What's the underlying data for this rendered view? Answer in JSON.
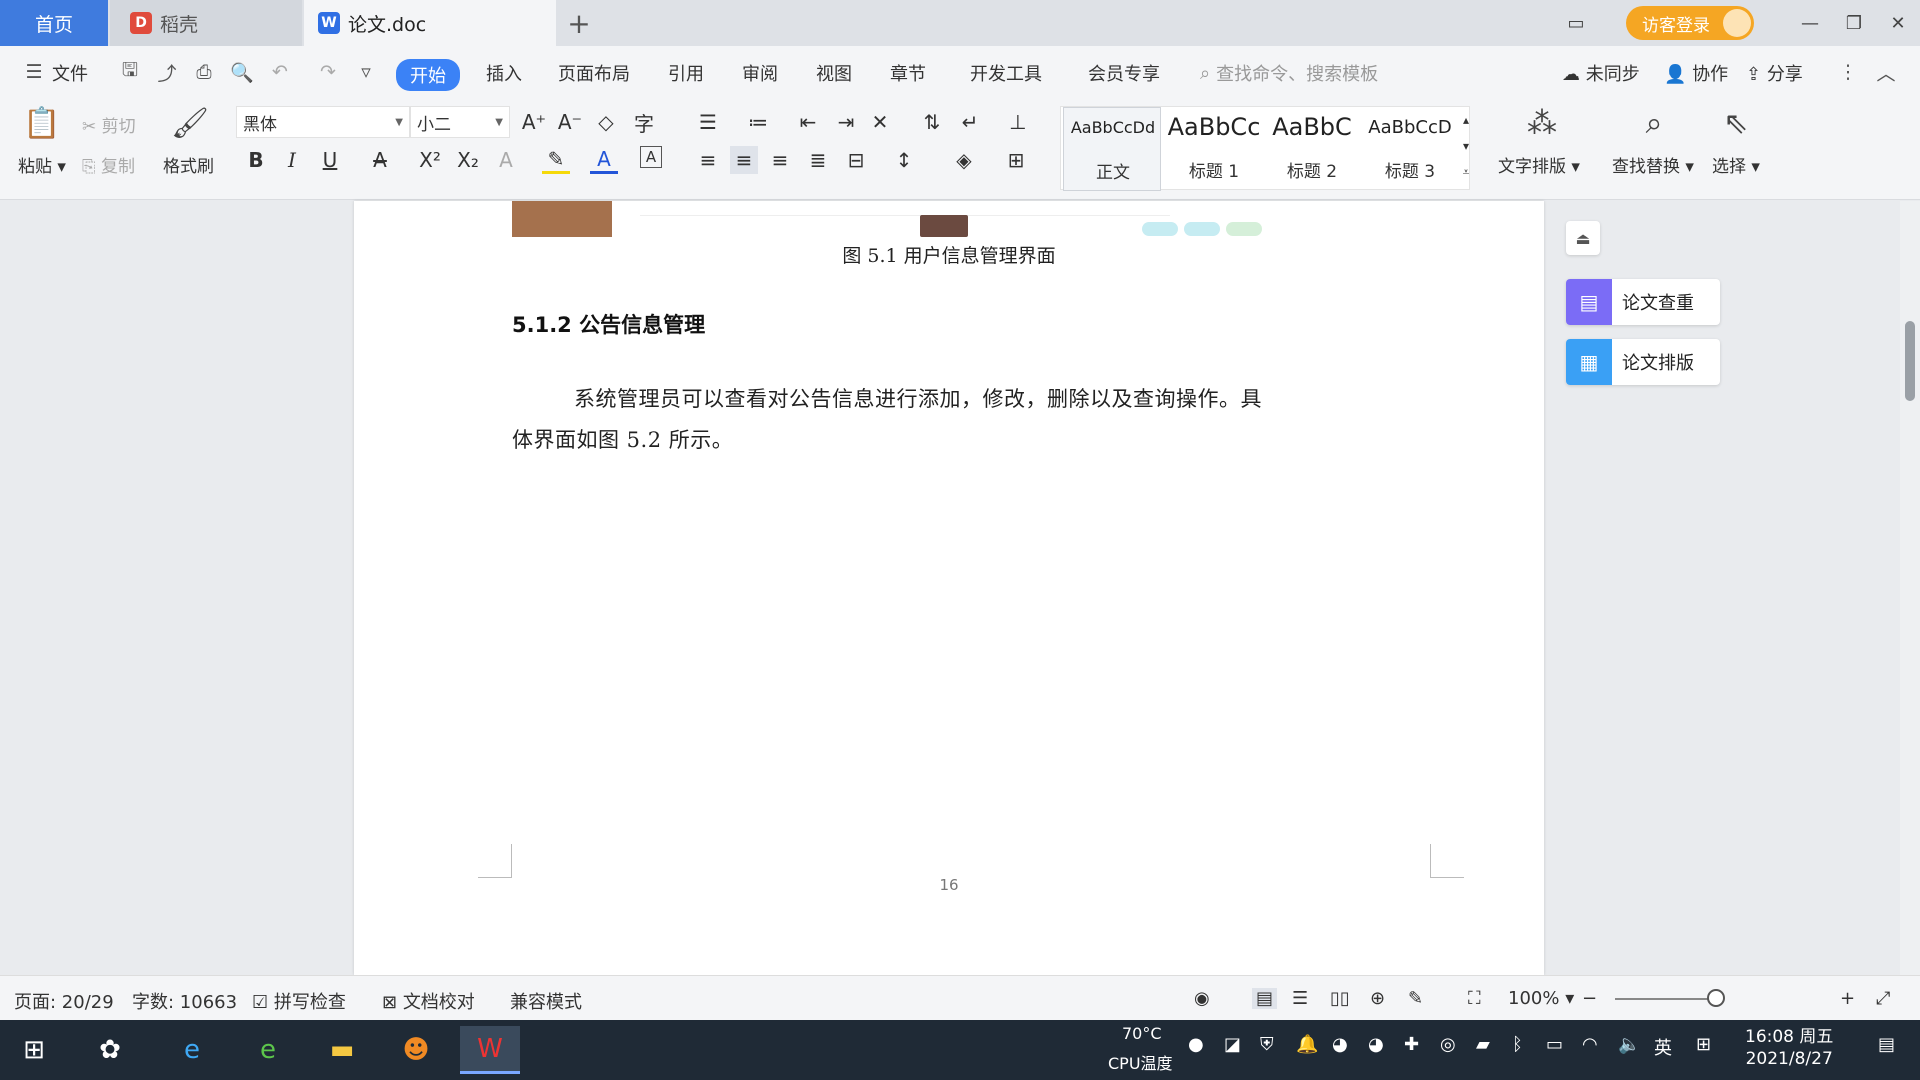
{
  "tabs": {
    "home": "首页",
    "daoke": "稻壳",
    "doc": "论文.doc"
  },
  "title_bar": {
    "login": "访客登录"
  },
  "menu": {
    "file": "文件",
    "items": [
      "开始",
      "插入",
      "页面布局",
      "引用",
      "审阅",
      "视图",
      "章节",
      "开发工具",
      "会员专享"
    ],
    "search_placeholder": "查找命令、搜索模板",
    "sync": "未同步",
    "collab": "协作",
    "share": "分享"
  },
  "ribbon": {
    "paste": "粘贴",
    "cut": "剪切",
    "copy": "复制",
    "format_painter": "格式刷",
    "font": "黑体",
    "font_size": "小二",
    "styles": [
      {
        "sample": "AaBbCcDd",
        "name": "正文"
      },
      {
        "sample": "AaBbCc",
        "name": "标题 1"
      },
      {
        "sample": "AaBbC",
        "name": "标题 2"
      },
      {
        "sample": "AaBbCcD",
        "name": "标题 3"
      }
    ],
    "text_layout": "文字排版",
    "find_replace": "查找替换",
    "select": "选择"
  },
  "document": {
    "figure_caption": "图 5.1  用户信息管理界面",
    "section_heading": "5.1.2  公告信息管理",
    "paragraph": "系统管理员可以查看对公告信息进行添加，修改，删除以及查询操作。具体界面如图 5.2 所示。",
    "page_number": "16"
  },
  "right_panel": {
    "check": "论文查重",
    "layout": "论文排版"
  },
  "status": {
    "page": "页面: 20/29",
    "words": "字数: 10663",
    "spell": "拼写检查",
    "proof": "文档校对",
    "compat": "兼容模式",
    "zoom": "100%"
  },
  "taskbar": {
    "cpu_temp": "70°C",
    "cpu_label": "CPU温度",
    "ime": "英",
    "time": "16:08 周五",
    "date": "2021/8/27"
  },
  "colors": {
    "accent": "#3b82f6",
    "login": "#f5a623",
    "check_icon": "#7b6cf6",
    "layout_icon": "#3aa0f5"
  }
}
